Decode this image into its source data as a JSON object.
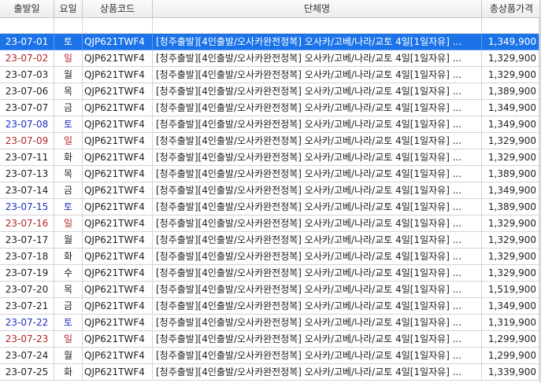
{
  "columns": {
    "date": "출발일",
    "day": "요일",
    "code": "상품코드",
    "name": "단체명",
    "price": "총상품가격"
  },
  "rows": [
    {
      "date": "23-07-01",
      "day": "토",
      "code": "QJP621TWF4",
      "name": "[청주출발][4인출발/오사카완전정복] 오사카/고베/나라/교토 4일[1일자유] ...",
      "price": "1,349,900",
      "weekday": "sat",
      "selected": true
    },
    {
      "date": "23-07-02",
      "day": "일",
      "code": "QJP621TWF4",
      "name": "[청주출발][4인출발/오사카완전정복] 오사카/고베/나라/교토 4일[1일자유] ...",
      "price": "1,329,900",
      "weekday": "sun"
    },
    {
      "date": "23-07-03",
      "day": "월",
      "code": "QJP621TWF4",
      "name": "[청주출발][4인출발/오사카완전정복] 오사카/고베/나라/교토 4일[1일자유] ...",
      "price": "1,329,900",
      "weekday": "mon"
    },
    {
      "date": "23-07-06",
      "day": "목",
      "code": "QJP621TWF4",
      "name": "[청주출발][4인출발/오사카완전정복] 오사카/고베/나라/교토 4일[1일자유] ...",
      "price": "1,389,900",
      "weekday": "thu"
    },
    {
      "date": "23-07-07",
      "day": "금",
      "code": "QJP621TWF4",
      "name": "[청주출발][4인출발/오사카완전정복] 오사카/고베/나라/교토 4일[1일자유] ...",
      "price": "1,349,900",
      "weekday": "fri"
    },
    {
      "date": "23-07-08",
      "day": "토",
      "code": "QJP621TWF4",
      "name": "[청주출발][4인출발/오사카완전정복] 오사카/고베/나라/교토 4일[1일자유] ...",
      "price": "1,349,900",
      "weekday": "sat"
    },
    {
      "date": "23-07-09",
      "day": "일",
      "code": "QJP621TWF4",
      "name": "[청주출발][4인출발/오사카완전정복] 오사카/고베/나라/교토 4일[1일자유] ...",
      "price": "1,329,900",
      "weekday": "sun"
    },
    {
      "date": "23-07-11",
      "day": "화",
      "code": "QJP621TWF4",
      "name": "[청주출발][4인출발/오사카완전정복] 오사카/고베/나라/교토 4일[1일자유] ...",
      "price": "1,329,900",
      "weekday": "tue"
    },
    {
      "date": "23-07-13",
      "day": "목",
      "code": "QJP621TWF4",
      "name": "[청주출발][4인출발/오사카완전정복] 오사카/고베/나라/교토 4일[1일자유] ...",
      "price": "1,389,900",
      "weekday": "thu"
    },
    {
      "date": "23-07-14",
      "day": "금",
      "code": "QJP621TWF4",
      "name": "[청주출발][4인출발/오사카완전정복] 오사카/고베/나라/교토 4일[1일자유] ...",
      "price": "1,349,900",
      "weekday": "fri"
    },
    {
      "date": "23-07-15",
      "day": "토",
      "code": "QJP621TWF4",
      "name": "[청주출발][4인출발/오사카완전정복] 오사카/고베/나라/교토 4일[1일자유] ...",
      "price": "1,389,900",
      "weekday": "sat"
    },
    {
      "date": "23-07-16",
      "day": "일",
      "code": "QJP621TWF4",
      "name": "[청주출발][4인출발/오사카완전정복] 오사카/고베/나라/교토 4일[1일자유] ...",
      "price": "1,329,900",
      "weekday": "sun"
    },
    {
      "date": "23-07-17",
      "day": "월",
      "code": "QJP621TWF4",
      "name": "[청주출발][4인출발/오사카완전정복] 오사카/고베/나라/교토 4일[1일자유] ...",
      "price": "1,329,900",
      "weekday": "mon"
    },
    {
      "date": "23-07-18",
      "day": "화",
      "code": "QJP621TWF4",
      "name": "[청주출발][4인출발/오사카완전정복] 오사카/고베/나라/교토 4일[1일자유] ...",
      "price": "1,329,900",
      "weekday": "tue"
    },
    {
      "date": "23-07-19",
      "day": "수",
      "code": "QJP621TWF4",
      "name": "[청주출발][4인출발/오사카완전정복] 오사카/고베/나라/교토 4일[1일자유] ...",
      "price": "1,329,900",
      "weekday": "wed"
    },
    {
      "date": "23-07-20",
      "day": "목",
      "code": "QJP621TWF4",
      "name": "[청주출발][4인출발/오사카완전정복] 오사카/고베/나라/교토 4일[1일자유] ...",
      "price": "1,519,900",
      "weekday": "thu"
    },
    {
      "date": "23-07-21",
      "day": "금",
      "code": "QJP621TWF4",
      "name": "[청주출발][4인출발/오사카완전정복] 오사카/고베/나라/교토 4일[1일자유] ...",
      "price": "1,349,900",
      "weekday": "fri"
    },
    {
      "date": "23-07-22",
      "day": "토",
      "code": "QJP621TWF4",
      "name": "[청주출발][4인출발/오사카완전정복] 오사카/고베/나라/교토 4일[1일자유] ...",
      "price": "1,319,900",
      "weekday": "sat"
    },
    {
      "date": "23-07-23",
      "day": "일",
      "code": "QJP621TWF4",
      "name": "[청주출발][4인출발/오사카완전정복] 오사카/고베/나라/교토 4일[1일자유] ...",
      "price": "1,299,900",
      "weekday": "sun"
    },
    {
      "date": "23-07-24",
      "day": "월",
      "code": "QJP621TWF4",
      "name": "[청주출발][4인출발/오사카완전정복] 오사카/고베/나라/교토 4일[1일자유] ...",
      "price": "1,299,900",
      "weekday": "mon"
    },
    {
      "date": "23-07-25",
      "day": "화",
      "code": "QJP621TWF4",
      "name": "[청주출발][4인출발/오사카완전정복] 오사카/고베/나라/교토 4일[1일자유] ...",
      "price": "1,339,900",
      "weekday": "tue"
    }
  ],
  "colors": {
    "selected_bg": "#1c73e8",
    "saturday": "#1a2fbf",
    "sunday": "#b32626"
  }
}
